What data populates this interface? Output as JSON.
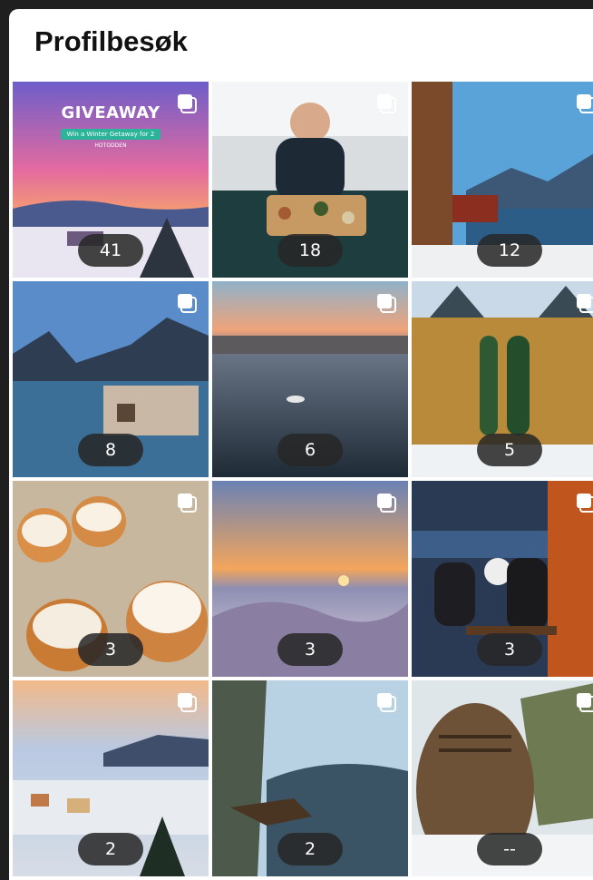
{
  "header": {
    "title": "Profilbesøk"
  },
  "giveaway": {
    "title": "GIVEAWAY",
    "subtitle": "Win a Winter Getaway for 2",
    "brand": "HOTODDEN"
  },
  "posts": [
    {
      "count": "41",
      "theme": "giveaway-sunset",
      "multiple": true
    },
    {
      "count": "18",
      "theme": "restaurant-platter",
      "multiple": true
    },
    {
      "count": "12",
      "theme": "fjord-cabin",
      "multiple": true
    },
    {
      "count": "8",
      "theme": "lake-sauna",
      "multiple": true
    },
    {
      "count": "6",
      "theme": "harbour-sunset",
      "multiple": true
    },
    {
      "count": "5",
      "theme": "dragon-style-hotel",
      "multiple": true
    },
    {
      "count": "3",
      "theme": "semla-buns",
      "multiple": true
    },
    {
      "count": "3",
      "theme": "mountain-sunset",
      "multiple": true
    },
    {
      "count": "3",
      "theme": "valentine-dinner",
      "multiple": true
    },
    {
      "count": "2",
      "theme": "snowy-town",
      "multiple": true
    },
    {
      "count": "2",
      "theme": "eagle-forest",
      "multiple": true
    },
    {
      "count": "--",
      "theme": "memorial-stone",
      "multiple": true
    }
  ],
  "icons": {
    "multiple": "carousel-stack-icon"
  },
  "colors": {
    "background": "#1f1f1f",
    "panel": "#ffffff",
    "badge": "#262626"
  }
}
